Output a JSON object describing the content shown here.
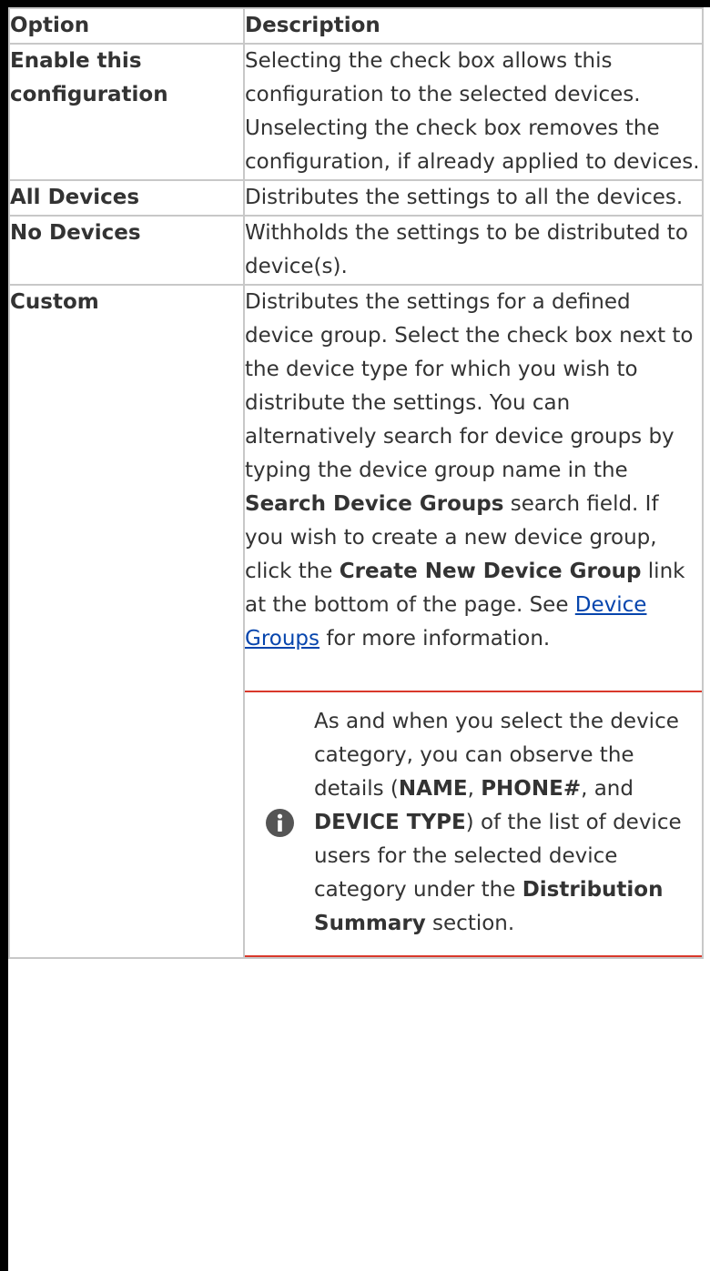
{
  "table": {
    "headers": {
      "option": "Option",
      "description": "Description"
    },
    "rows": [
      {
        "option": "Enable this configuration",
        "description": "Selecting the check box allows this configuration to the selected devices. Unselecting the check box removes the configuration, if already applied to devices."
      },
      {
        "option": "All Devices",
        "description": "Distributes the settings to all the devices."
      },
      {
        "option": "No Devices",
        "description": "Withholds the settings to be distributed to device(s)."
      },
      {
        "option": "Custom",
        "description": {
          "t1": "Distributes the settings for a defined device group. Select the check box next to the device type for which you wish to distribute the settings. You can alternatively search for device groups by typing the device group name in the ",
          "b1": "Search Device Groups",
          "t2": " search field. If you wish to create a new device group, click the ",
          "b2": "Create New Device Group",
          "t3": " link at the bottom of the page. See ",
          "link": "Device Groups",
          "t4": " for more information."
        },
        "note": {
          "icon": "info-icon",
          "t1": "As and when you select the device category, you can observe the details (",
          "b1": "NAME",
          "t2": ", ",
          "b2": "PHONE#",
          "t3": ", and ",
          "b3": "DEVICE TYPE",
          "t4": ") of the list of device users for the selected device category under the ",
          "b4": "Distribution Summary",
          "t5": " section."
        }
      }
    ]
  },
  "colors": {
    "link": "#0645ad",
    "note_rule": "#d9382b",
    "border": "#c8c8c8",
    "text": "#333333"
  }
}
